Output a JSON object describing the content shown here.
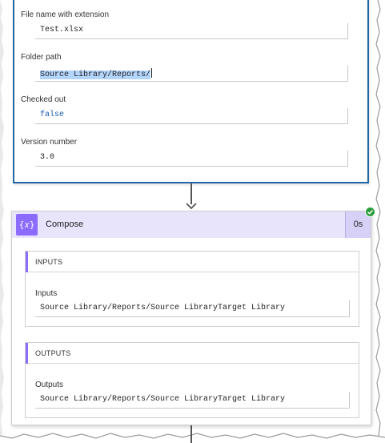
{
  "action": {
    "fields": [
      {
        "label": "File name with extension",
        "value": "Test.xlsx"
      },
      {
        "label": "Folder path",
        "value": "Source Library/Reports/"
      },
      {
        "label": "Checked out",
        "value": "false"
      },
      {
        "label": "Version number",
        "value": "3.0"
      }
    ]
  },
  "compose": {
    "title": "Compose",
    "icon": "{𝑥}",
    "duration": "0s",
    "status_icon": "check-circle-icon",
    "accent_color": "#8c6cff",
    "header_color": "#e8e4fb",
    "inputs": {
      "section_title": "INPUTS",
      "label": "Inputs",
      "value": "Source Library/Reports/Source LibraryTarget Library"
    },
    "outputs": {
      "section_title": "OUTPUTS",
      "label": "Outputs",
      "value": "Source Library/Reports/Source LibraryTarget Library"
    }
  }
}
